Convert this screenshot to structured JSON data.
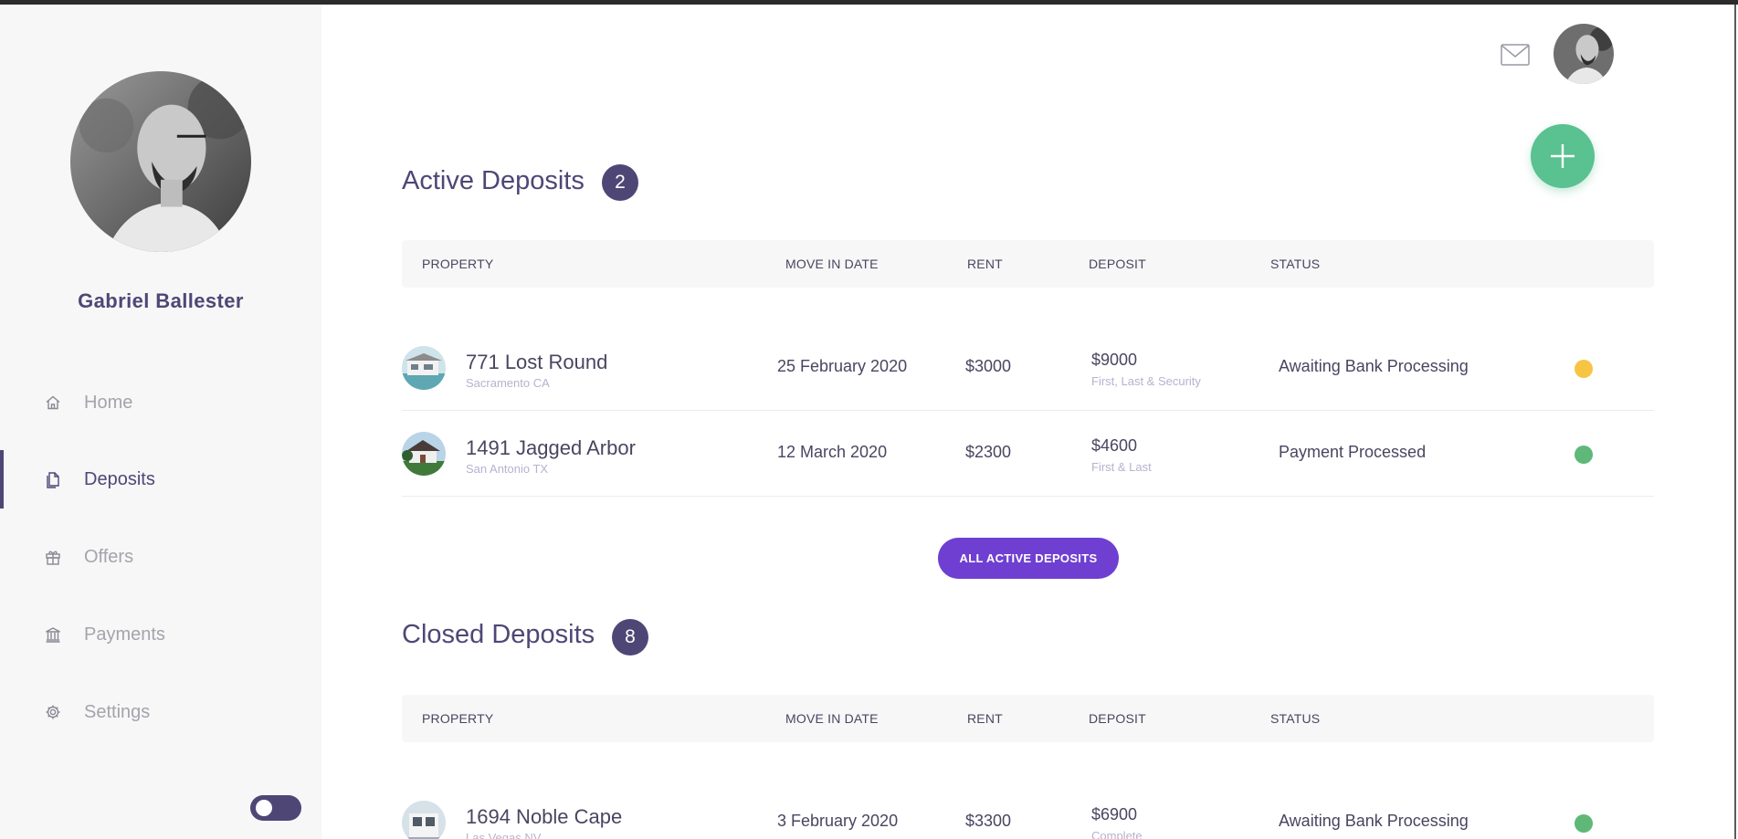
{
  "user": {
    "name": "Gabriel Ballester"
  },
  "nav": {
    "items": [
      {
        "label": "Home",
        "icon": "home-icon",
        "active": false
      },
      {
        "label": "Deposits",
        "icon": "document-icon",
        "active": true
      },
      {
        "label": "Offers",
        "icon": "gift-icon",
        "active": false
      },
      {
        "label": "Payments",
        "icon": "bank-icon",
        "active": false
      },
      {
        "label": "Settings",
        "icon": "gear-icon",
        "active": false
      }
    ]
  },
  "header": {
    "mail_icon": "mail-icon",
    "add_icon": "plus-icon"
  },
  "colors": {
    "accent": "#4e4776",
    "button": "#6f3fd2",
    "fab": "#5ac190",
    "status_pending": "#f6c544",
    "status_done": "#5fb878"
  },
  "active": {
    "title": "Active Deposits",
    "count": "2",
    "columns": [
      "PROPERTY",
      "MOVE IN DATE",
      "RENT",
      "DEPOSIT",
      "STATUS"
    ],
    "rows": [
      {
        "name": "771 Lost Round",
        "city": "Sacramento CA",
        "date": "25 February 2020",
        "rent": "$3000",
        "deposit": "$9000",
        "deposit_note": "First, Last & Security",
        "status": "Awaiting Bank Processing",
        "status_color": "#f6c544"
      },
      {
        "name": "1491 Jagged Arbor",
        "city": "San Antonio TX",
        "date": "12 March 2020",
        "rent": "$2300",
        "deposit": "$4600",
        "deposit_note": "First & Last",
        "status": "Payment Processed",
        "status_color": "#5fb878"
      }
    ],
    "button": "ALL ACTIVE DEPOSITS"
  },
  "closed": {
    "title": "Closed Deposits",
    "count": "8",
    "columns": [
      "PROPERTY",
      "MOVE IN DATE",
      "RENT",
      "DEPOSIT",
      "STATUS"
    ],
    "rows": [
      {
        "name": "1694 Noble Cape",
        "city": "Las Vegas NV",
        "date": "3 February 2020",
        "rent": "$3300",
        "deposit": "$6900",
        "deposit_note": "Complete",
        "status": "Awaiting Bank Processing",
        "status_color": "#5fb878"
      }
    ]
  }
}
